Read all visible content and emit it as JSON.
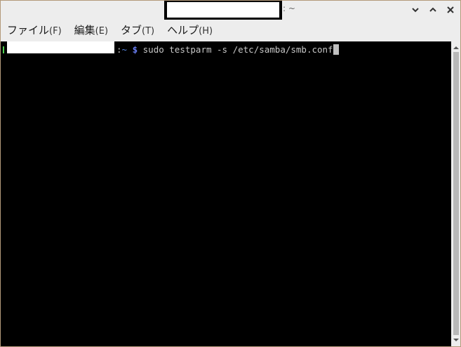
{
  "window": {
    "title_suffix": ": ~"
  },
  "menubar": {
    "items": [
      {
        "label": "ファイル",
        "accel": "(F)"
      },
      {
        "label": "編集",
        "accel": "(E)"
      },
      {
        "label": "タブ",
        "accel": "(T)"
      },
      {
        "label": "ヘルプ",
        "accel": "(H)"
      }
    ]
  },
  "terminal": {
    "prompt_host_suffix": ":",
    "prompt_dir": "~",
    "prompt_symbol": "$",
    "command": "sudo testparm -s /etc/samba/smb.conf"
  },
  "icons": {
    "minimize": "chevron-down-icon",
    "maximize": "chevron-up-icon",
    "close": "close-icon"
  }
}
